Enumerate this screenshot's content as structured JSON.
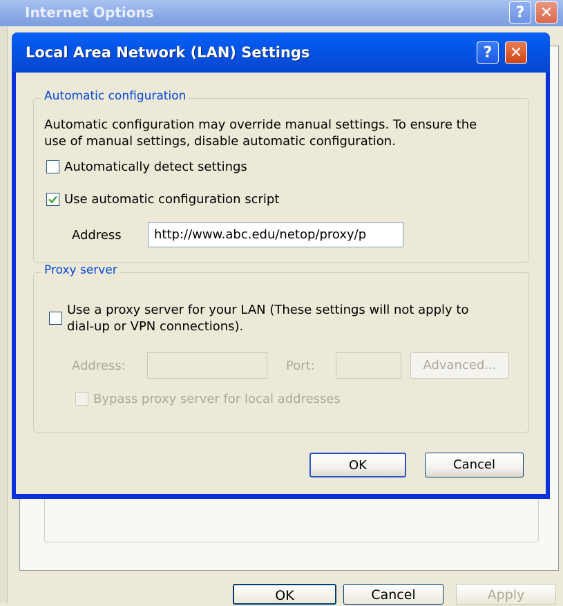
{
  "background_window": {
    "title": "Internet Options",
    "help_glyph": "?",
    "close_glyph": "✕",
    "buttons": {
      "ok": "OK",
      "cancel": "Cancel",
      "apply": "Apply"
    }
  },
  "lan_dialog": {
    "title": "Local Area Network (LAN) Settings",
    "help_glyph": "?",
    "close_glyph": "✕",
    "automatic_configuration": {
      "legend": "Automatic configuration",
      "description_line1": "Automatic configuration may override manual settings.  To ensure the",
      "description_line2": "use of manual settings, disable automatic configuration.",
      "auto_detect_label": "Automatically detect settings",
      "auto_detect_checked": false,
      "use_script_label": "Use automatic configuration script",
      "use_script_checked": true,
      "address_label": "Address",
      "address_value": "http://www.abc.edu/netop/proxy/p"
    },
    "proxy_server": {
      "legend": "Proxy server",
      "use_proxy_line1": "Use a proxy server for your LAN (These settings will not apply to",
      "use_proxy_line2": "dial-up or VPN connections).",
      "use_proxy_checked": false,
      "address_label": "Address:",
      "address_value": "",
      "port_label": "Port:",
      "port_value": "",
      "advanced_label": "Advanced...",
      "bypass_label": "Bypass proxy server for local addresses",
      "bypass_checked": false
    },
    "buttons": {
      "ok": "OK",
      "cancel": "Cancel"
    }
  },
  "colors": {
    "titlebar_blue": "#0454e6",
    "legend_blue": "#0046d5",
    "dialog_face": "#ece9d8",
    "disabled_text": "#aca899"
  },
  "icons": [
    "help-icon",
    "close-icon",
    "checkmark-icon"
  ]
}
